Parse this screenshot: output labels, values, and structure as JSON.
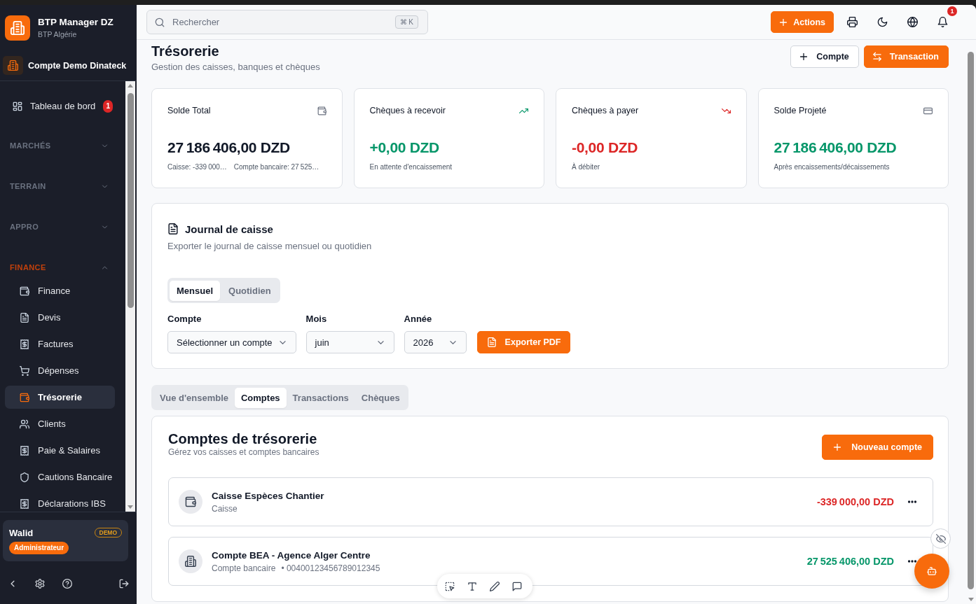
{
  "sidebar": {
    "brand": {
      "name": "BTP Manager DZ",
      "subtitle": "BTP Algérie"
    },
    "account": "Compte Demo Dinateck",
    "items": [
      {
        "label": "Tableau de bord",
        "badge": "1",
        "selected": false
      }
    ],
    "sections": [
      {
        "label": "MARCHÉS",
        "expanded": false
      },
      {
        "label": "TERRAIN",
        "expanded": false
      },
      {
        "label": "APPRO",
        "expanded": false
      },
      {
        "label": "FINANCE",
        "expanded": true,
        "children": [
          {
            "label": "Finance",
            "selected": false
          },
          {
            "label": "Devis",
            "selected": false
          },
          {
            "label": "Factures",
            "selected": false
          },
          {
            "label": "Dépenses",
            "selected": false
          },
          {
            "label": "Trésorerie",
            "selected": true
          },
          {
            "label": "Clients",
            "selected": false
          },
          {
            "label": "Paie & Salaires",
            "selected": false
          },
          {
            "label": "Cautions Bancaire",
            "selected": false
          },
          {
            "label": "Déclarations IBS",
            "selected": false
          }
        ]
      }
    ],
    "user": {
      "name": "Walid",
      "badge": "DEMO",
      "role": "Administrateur"
    }
  },
  "topbar": {
    "search": {
      "placeholder": "Rechercher",
      "shortcut": "⌘ K"
    },
    "actions_button": "Actions",
    "notification_count": "1"
  },
  "page": {
    "title": "Trésorerie",
    "subtitle": "Gestion des caisses, banques et chèques",
    "buttons": [
      {
        "label": "Compte",
        "kind": "outline"
      },
      {
        "label": "Transaction",
        "kind": "primary"
      }
    ]
  },
  "stats": [
    {
      "title": "Solde Total",
      "value": "27 186 406,00 DZD",
      "color": "#111827",
      "notes": [
        "Caisse: -339 000…",
        "Compte bancaire: 27 525…"
      ]
    },
    {
      "title": "Chèques à recevoir",
      "value": "+0,00 DZD",
      "color": "#059669",
      "notes": [
        "En attente d'encaissement"
      ]
    },
    {
      "title": "Chèques à payer",
      "value": "-0,00 DZD",
      "color": "#dc2626",
      "notes": [
        "À débiter"
      ]
    },
    {
      "title": "Solde Projeté",
      "value": "27 186 406,00 DZD",
      "color": "#059669",
      "notes": [
        "Après encaissements/décaissements"
      ]
    }
  ],
  "journal": {
    "title": "Journal de caisse",
    "subtitle": "Exporter le journal de caisse mensuel ou quotidien",
    "modes": [
      {
        "label": "Mensuel",
        "selected": true
      },
      {
        "label": "Quotidien",
        "selected": false
      }
    ],
    "fields": [
      {
        "label": "Compte",
        "value": "Sélectionner un compte"
      },
      {
        "label": "Mois",
        "value": "juin"
      },
      {
        "label": "Année",
        "value": "2026"
      }
    ],
    "export_button": "Exporter PDF"
  },
  "tabs": [
    {
      "label": "Vue d'ensemble",
      "selected": false
    },
    {
      "label": "Comptes",
      "selected": true
    },
    {
      "label": "Transactions",
      "selected": false
    },
    {
      "label": "Chèques",
      "selected": false
    }
  ],
  "accounts": {
    "title": "Comptes de trésorerie",
    "subtitle": "Gérez vos caisses et comptes bancaires",
    "new_button": "Nouveau compte",
    "rows": [
      {
        "kind": "cash",
        "name": "Caisse Espèces Chantier",
        "type": "Caisse",
        "amount": "-339 000,00 DZD",
        "color": "#dc2626"
      },
      {
        "kind": "bank",
        "name": "Compte BEA - Agence Alger Centre",
        "type": "Compte bancaire",
        "number": "• 00400123456789012345",
        "amount": "27 525 406,00 DZD",
        "color": "#059669"
      }
    ]
  }
}
